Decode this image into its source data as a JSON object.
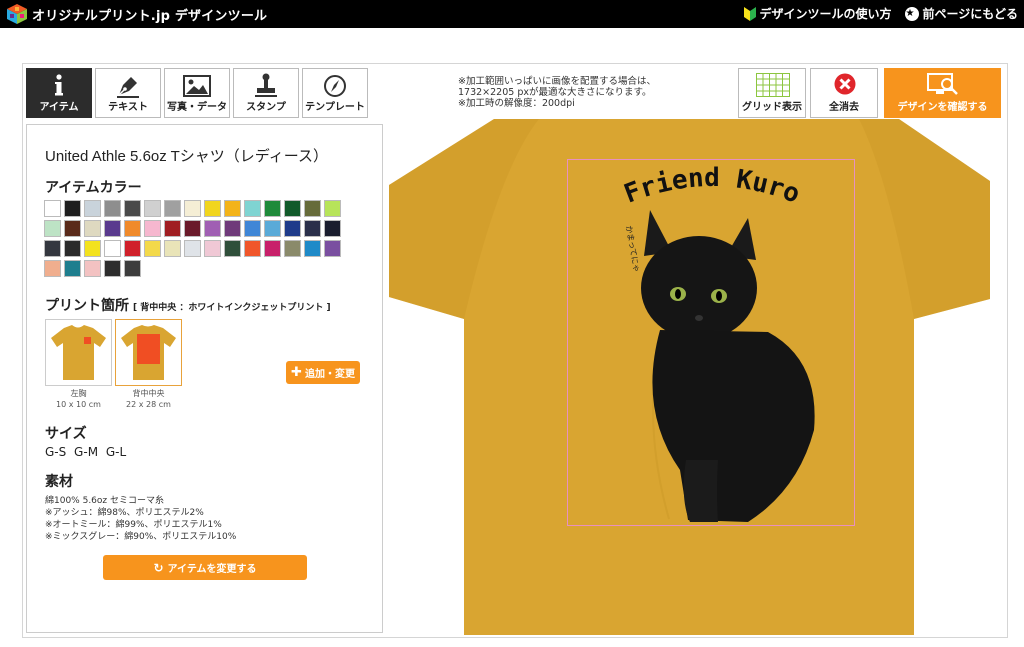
{
  "header": {
    "brand": "オリジナルプリント.jp デザインツール",
    "help_link": "デザインツールの使い方",
    "back_link": "前ページにもどる"
  },
  "tabs": [
    {
      "label": "アイテム",
      "icon": "info-icon"
    },
    {
      "label": "テキスト",
      "icon": "pen-icon"
    },
    {
      "label": "写真・データ",
      "icon": "image-icon"
    },
    {
      "label": "スタンプ",
      "icon": "stamp-icon"
    },
    {
      "label": "テンプレート",
      "icon": "compass-icon"
    }
  ],
  "panel": {
    "product_title": "United Athle 5.6oz Tシャツ（レディース）",
    "color_heading": "アイテムカラー",
    "colors": [
      "#ffffff",
      "#1e1e1e",
      "#c9d3db",
      "#8e8e8e",
      "#4a4a4a",
      "#d0d0d0",
      "#a0a0a0",
      "#f5eed5",
      "#f1d51e",
      "#f3b31a",
      "#7fd4d2",
      "#1f8a3a",
      "#115a2a",
      "#666b3a",
      "#b7e45a",
      "#bde3c5",
      "#5a2a1a",
      "#ded9c0",
      "#5a3a8e",
      "#f08a2a",
      "#f6b7cf",
      "#a01e22",
      "#6a1a2a",
      "#a05fb3",
      "#6f3a7a",
      "#3f86d6",
      "#5aaad8",
      "#1f3b8a",
      "#2a2f4a",
      "#1a1d2e",
      "#34373f",
      "#2a2a2a",
      "#f3e21e",
      "#ffffff",
      "#d0202a",
      "#f3d94a",
      "#e9e4b8",
      "#dfe3e8",
      "#f0c8d5",
      "#2f4f3a",
      "#f0562a",
      "#c8206a",
      "#8a8a6a",
      "#1f8ac8",
      "#7a4fa0",
      "#f0ae8e",
      "#1e7e8e",
      "#f3c2c2",
      "#2d2d2d",
      "#3c3c3c"
    ],
    "print_heading": "プリント箇所",
    "print_note": "[ 背中中央 ：ホワイトインクジェットプリント ]",
    "locations": [
      {
        "name": "左胸",
        "size": "10 x 10 cm"
      },
      {
        "name": "背中中央",
        "size": "22 x 28 cm"
      }
    ],
    "add_label": "追加・変更",
    "size_heading": "サイズ",
    "sizes": "G-S G-M G-L",
    "material_heading": "素材",
    "material_lines": [
      "綿100% 5.6oz セミコーマ糸",
      "※アッシュ：綿98%、ポリエステル2%",
      "※オートミール：綿99%、ポリエステル1%",
      "※ミックスグレー：綿90%、ポリエステル10%"
    ],
    "change_label": "アイテムを変更する"
  },
  "notes": [
    "※加工範囲いっぱいに画像を配置する場合は、",
    "1732×2205 pxが最適な大きさになります。",
    "※加工時の解像度：200dpi"
  ],
  "toolbar": {
    "grid_label": "グリッド表示",
    "clear_label": "全消去",
    "confirm_label": "デザインを確認する"
  },
  "design": {
    "shirt_color": "#d9a531",
    "title": "Friend Kuro",
    "small_text": "かまってにゃ"
  }
}
